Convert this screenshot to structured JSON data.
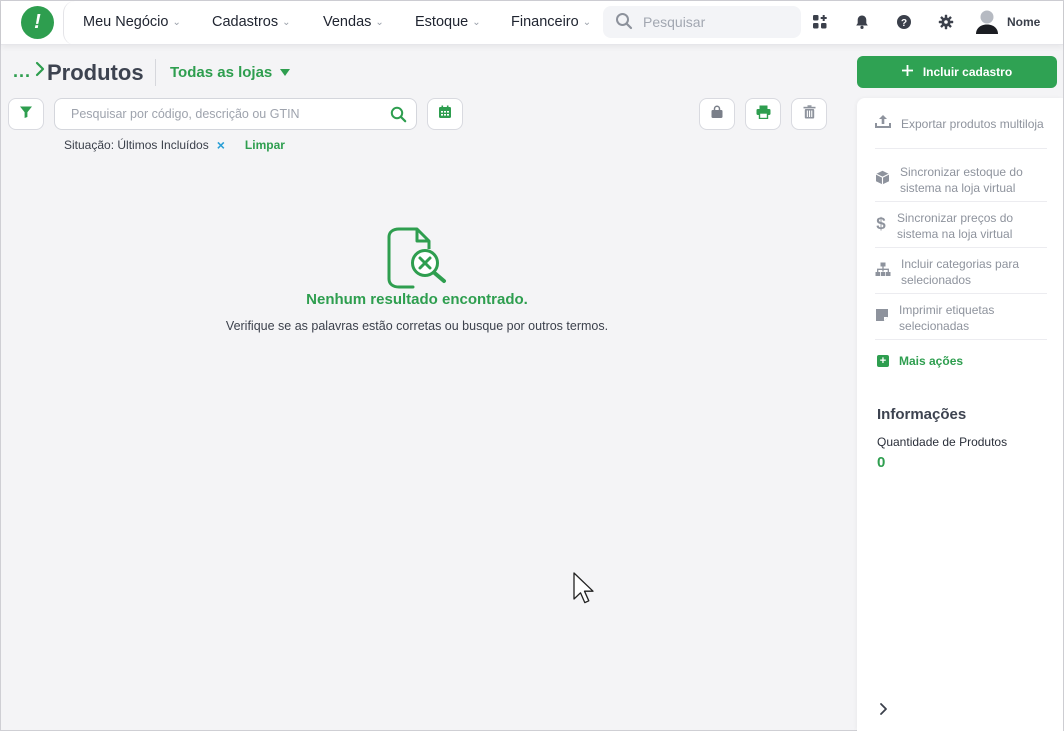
{
  "topbar": {
    "logo_glyph": "!",
    "nav": [
      {
        "label": "Meu Negócio"
      },
      {
        "label": "Cadastros"
      },
      {
        "label": "Vendas"
      },
      {
        "label": "Estoque"
      },
      {
        "label": "Financeiro"
      }
    ],
    "search_placeholder": "Pesquisar",
    "user_name": "Nome"
  },
  "header": {
    "breadcrumb_dots": "...",
    "title": "Produtos",
    "store_select": "Todas as lojas",
    "include_button": "Incluir cadastro"
  },
  "toolbar": {
    "search_placeholder": "Pesquisar por código, descrição ou GTIN"
  },
  "filters": {
    "situation": "Situação: Últimos Incluídos",
    "remove_glyph": "×",
    "clear_label": "Limpar"
  },
  "empty_state": {
    "title": "Nenhum resultado encontrado.",
    "subtitle": "Verifique se as palavras estão corretas ou busque por outros termos."
  },
  "side_panel": {
    "actions": [
      {
        "label": "Exportar produtos multiloja",
        "icon": "upload-icon"
      },
      {
        "label": "Sincronizar estoque do sistema na loja virtual",
        "icon": "box-icon"
      },
      {
        "label": "Sincronizar preços do sistema na loja virtual",
        "icon": "dollar-icon"
      },
      {
        "label": "Incluir categorias para selecionados",
        "icon": "sitemap-icon"
      },
      {
        "label": "Imprimir etiquetas selecionadas",
        "icon": "label-icon"
      }
    ],
    "more_actions": "Mais ações",
    "info_title": "Informações",
    "info_label": "Quantidade de Produtos",
    "info_value": "0"
  },
  "colors": {
    "accent": "#2e9e4f",
    "muted_text": "#8e939d",
    "link_blue": "#2a9fd6"
  }
}
